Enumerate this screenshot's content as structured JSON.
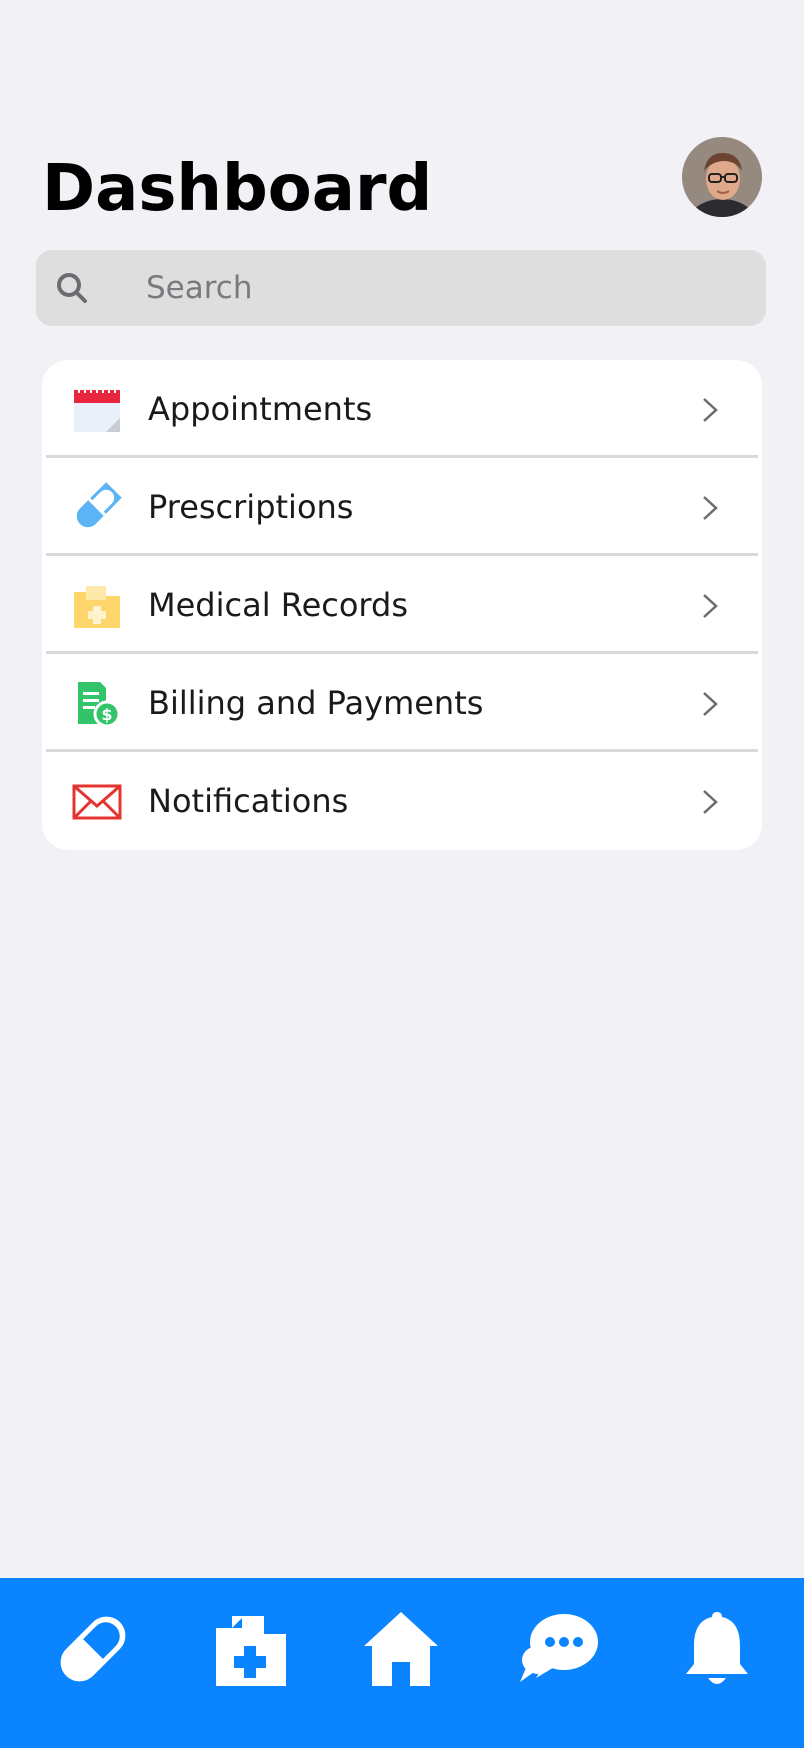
{
  "header": {
    "title": "Dashboard",
    "avatar_alt": "User profile"
  },
  "search": {
    "placeholder": "Search"
  },
  "menu": {
    "items": [
      {
        "label": "Appointments",
        "icon": "calendar-icon"
      },
      {
        "label": "Prescriptions",
        "icon": "pill-icon"
      },
      {
        "label": "Medical Records",
        "icon": "medical-folder-icon"
      },
      {
        "label": "Billing and Payments",
        "icon": "billing-icon"
      },
      {
        "label": "Notifications",
        "icon": "envelope-icon"
      }
    ]
  },
  "tabbar": {
    "items": [
      {
        "icon": "pill-icon"
      },
      {
        "icon": "medical-folder-icon"
      },
      {
        "icon": "home-icon"
      },
      {
        "icon": "chat-icon"
      },
      {
        "icon": "bell-icon"
      }
    ]
  },
  "colors": {
    "background": "#F1F1F6",
    "accent": "#0A84FF",
    "card": "#FFFFFF",
    "search_bg": "#DEDEDF"
  }
}
